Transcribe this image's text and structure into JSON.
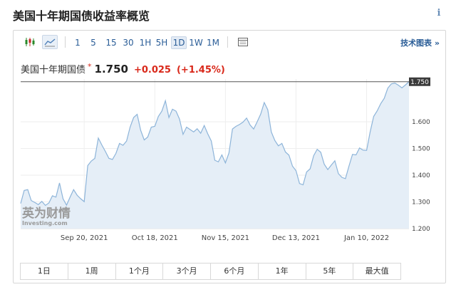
{
  "header": {
    "title": "美国十年期国债收益率概览",
    "info_label": "i"
  },
  "toolbar": {
    "chart_type_icons": [
      "candlestick-icon",
      "area-chart-icon"
    ],
    "periods": [
      "1",
      "5",
      "15",
      "30",
      "1H",
      "5H",
      "1D",
      "1W",
      "1M"
    ],
    "active_period": "1D",
    "settings_icon": "table-icon",
    "advanced_chart_label": "技术图表 »"
  },
  "quote": {
    "name": "美国十年期国债",
    "star": "*",
    "price": "1.750",
    "change": "+0.025",
    "change_pct": "(+1.45%)",
    "change_color": "#d9281a"
  },
  "watermark": {
    "brand": "英为财情",
    "site": "Investing.com"
  },
  "chart_data": {
    "type": "area",
    "title": "",
    "xlabel": "",
    "ylabel": "",
    "ylim": [
      1.2,
      1.76
    ],
    "y_ticks": [
      "1.200",
      "1.300",
      "1.400",
      "1.500",
      "1.600"
    ],
    "x_tick_labels": [
      "Sep 20, 2021",
      "Oct 18, 2021",
      "Nov 15, 2021",
      "Dec 13, 2021",
      "Jan 10, 2022"
    ],
    "x_tick_index": [
      18,
      38,
      58,
      78,
      98
    ],
    "current_value_label": "1.750",
    "current_value": 1.75,
    "line_color": "#8db4d9",
    "fill_color": "#e5eef7",
    "grid": true,
    "series": [
      {
        "values": [
          1.294,
          1.343,
          1.346,
          1.305,
          1.298,
          1.29,
          1.302,
          1.287,
          1.296,
          1.323,
          1.318,
          1.371,
          1.312,
          1.288,
          1.318,
          1.346,
          1.325,
          1.312,
          1.301,
          1.436,
          1.453,
          1.463,
          1.539,
          1.513,
          1.489,
          1.463,
          1.459,
          1.482,
          1.519,
          1.512,
          1.528,
          1.58,
          1.616,
          1.628,
          1.568,
          1.532,
          1.543,
          1.58,
          1.583,
          1.62,
          1.64,
          1.679,
          1.616,
          1.647,
          1.64,
          1.61,
          1.553,
          1.58,
          1.571,
          1.562,
          1.574,
          1.557,
          1.586,
          1.555,
          1.528,
          1.456,
          1.45,
          1.476,
          1.446,
          1.483,
          1.573,
          1.583,
          1.59,
          1.599,
          1.614,
          1.588,
          1.573,
          1.6,
          1.629,
          1.672,
          1.645,
          1.562,
          1.53,
          1.51,
          1.519,
          1.487,
          1.475,
          1.434,
          1.417,
          1.369,
          1.364,
          1.412,
          1.424,
          1.473,
          1.497,
          1.486,
          1.441,
          1.421,
          1.438,
          1.454,
          1.406,
          1.392,
          1.387,
          1.434,
          1.478,
          1.476,
          1.502,
          1.494,
          1.493,
          1.562,
          1.62,
          1.641,
          1.668,
          1.688,
          1.726,
          1.742,
          1.745,
          1.737,
          1.727,
          1.738,
          1.75
        ]
      }
    ]
  },
  "range_buttons": [
    "1日",
    "1周",
    "1个月",
    "3个月",
    "6个月",
    "1年",
    "5年",
    "最大值"
  ]
}
